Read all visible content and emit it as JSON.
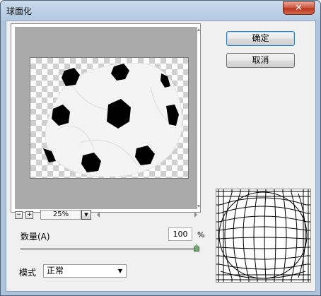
{
  "window": {
    "title": "球面化",
    "close_glyph": "✕"
  },
  "preview": {
    "zoom_value": "25%",
    "zoom_out_glyph": "−",
    "zoom_in_glyph": "+",
    "dropdown_glyph": "▼"
  },
  "buttons": {
    "ok_label": "确定",
    "cancel_label": "取消"
  },
  "amount": {
    "label": "数量(A)",
    "value": "100",
    "unit": "%",
    "slider_fraction": 1.0
  },
  "mode": {
    "label": "模式",
    "selected": "正常",
    "arrow_glyph": "▼"
  },
  "colors": {
    "title_bar": "#c0d4e9",
    "preview_bg": "#aaaaaa",
    "close_red": "#c8513a"
  }
}
